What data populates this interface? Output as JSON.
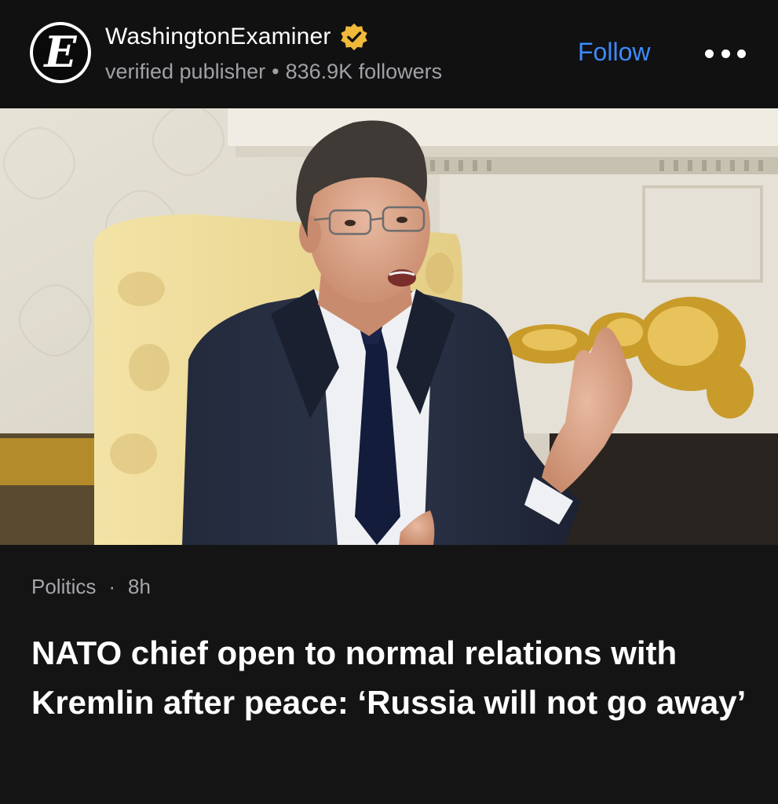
{
  "publisher": {
    "logo_letter": "E",
    "name": "WashingtonExaminer",
    "status": "verified publisher",
    "separator": "•",
    "followers": "836.9K followers",
    "follow_label": "Follow",
    "verified_color": "#f0b93a"
  },
  "article": {
    "category": "Politics",
    "separator": "·",
    "age": "8h",
    "headline": "NATO chief open to normal relations with Kremlin after peace: ‘Russia will not go away’"
  },
  "colors": {
    "background": "#111112",
    "accent": "#3d8bfd"
  }
}
